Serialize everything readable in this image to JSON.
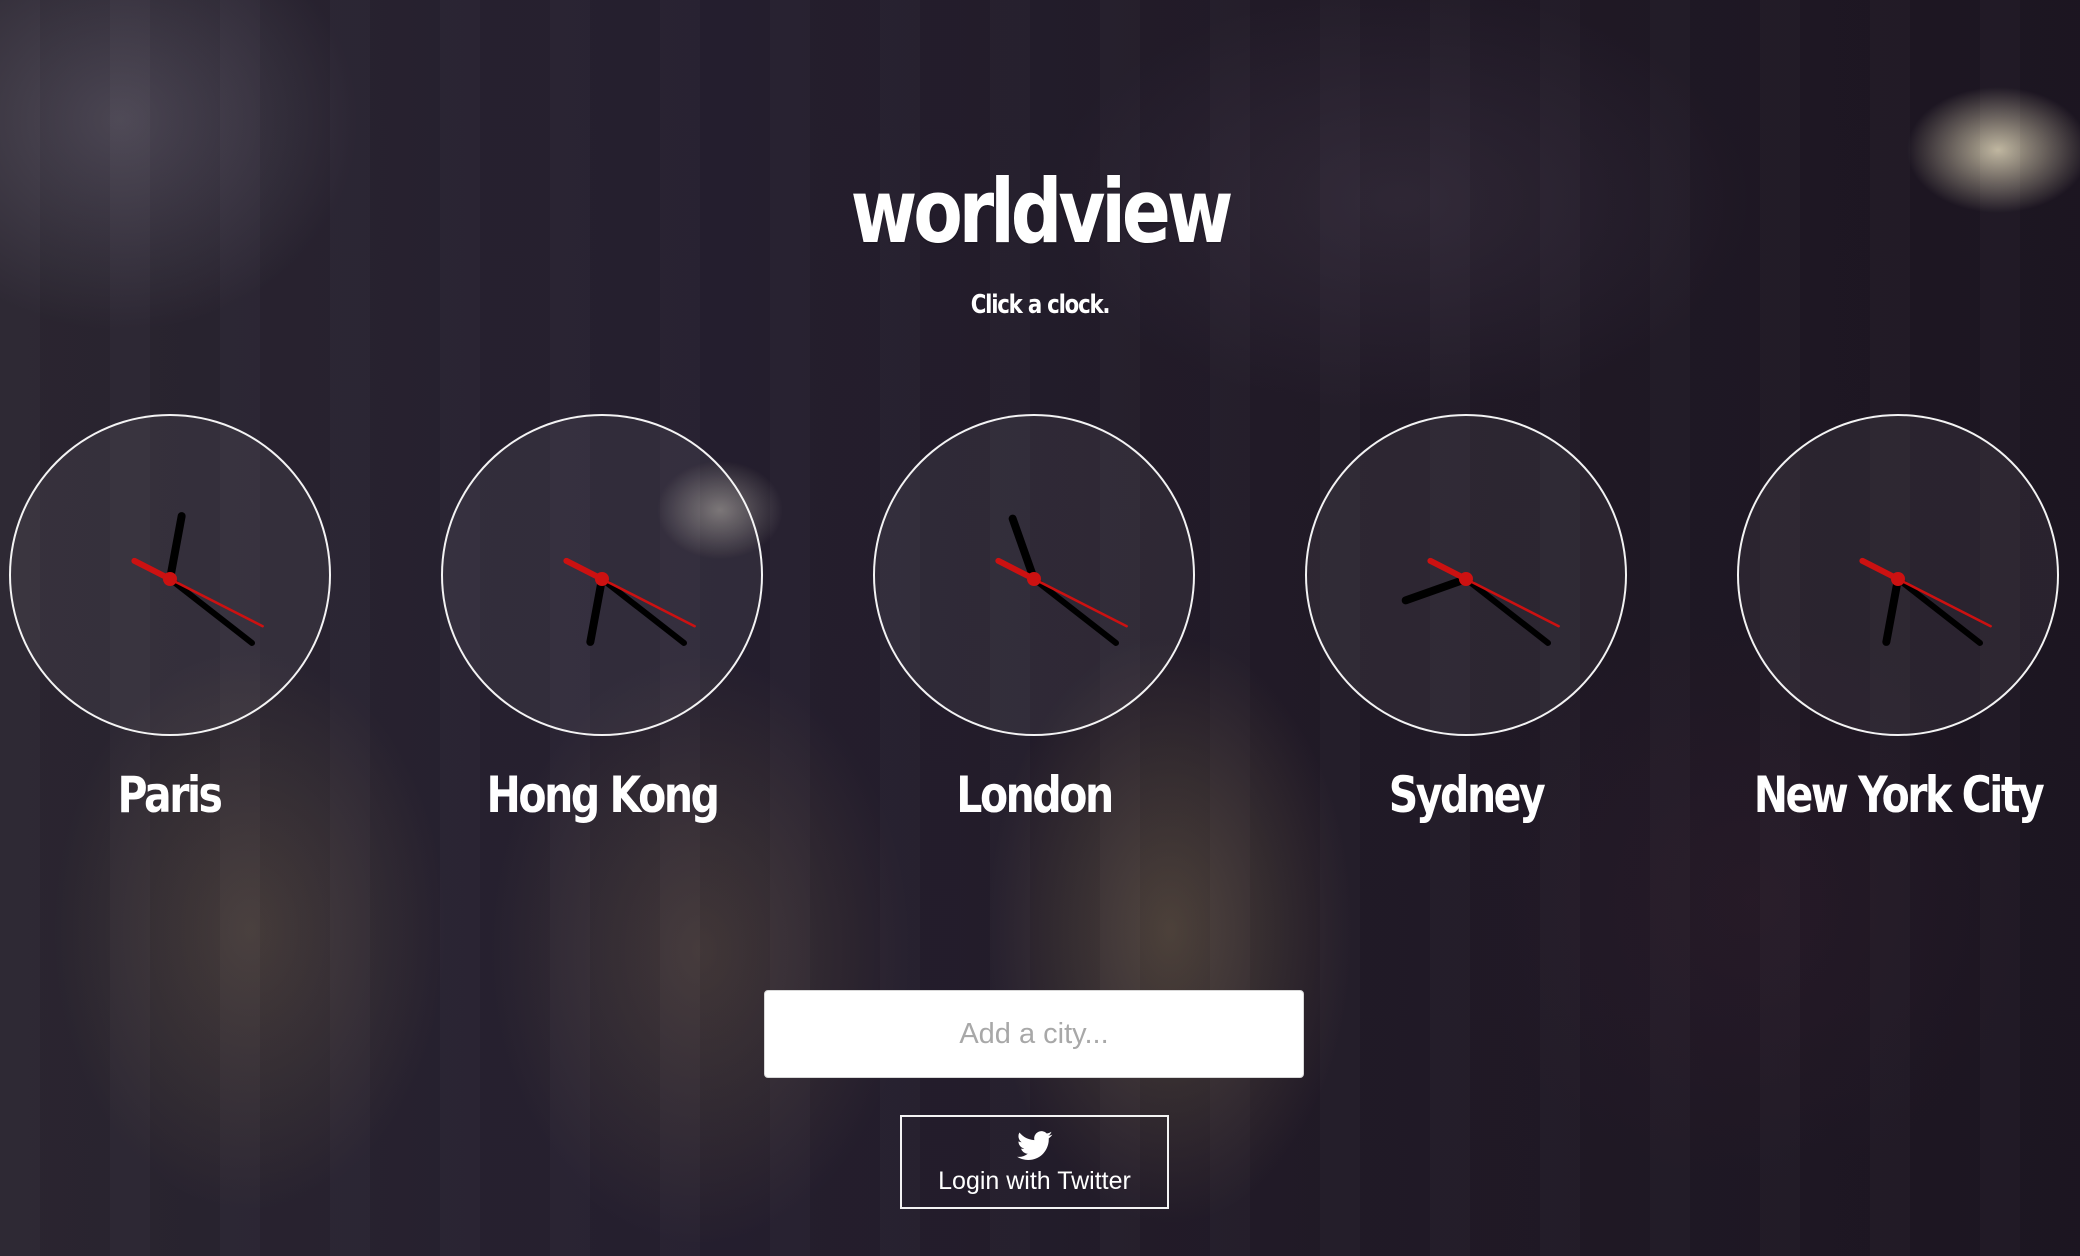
{
  "app": {
    "title": "worldview",
    "subtitle": "Click a clock."
  },
  "clocks": [
    {
      "city": "Paris",
      "time": {
        "hour": 12,
        "minute": 21,
        "second": 19.5
      }
    },
    {
      "city": "Hong Kong",
      "time": {
        "hour": 6,
        "minute": 21,
        "second": 19.5
      }
    },
    {
      "city": "London",
      "time": {
        "hour": 11,
        "minute": 21,
        "second": 19.5
      }
    },
    {
      "city": "Sydney",
      "time": {
        "hour": 8,
        "minute": 21,
        "second": 19.5
      }
    },
    {
      "city": "New York City",
      "time": {
        "hour": 6,
        "minute": 21,
        "second": 19.5
      }
    }
  ],
  "colors": {
    "hands": "#000000",
    "second_hand": "#cc1111",
    "clock_border": "#ffffff"
  },
  "search": {
    "placeholder": "Add a city..."
  },
  "login": {
    "label": "Login with Twitter",
    "icon": "twitter-bird-icon"
  }
}
